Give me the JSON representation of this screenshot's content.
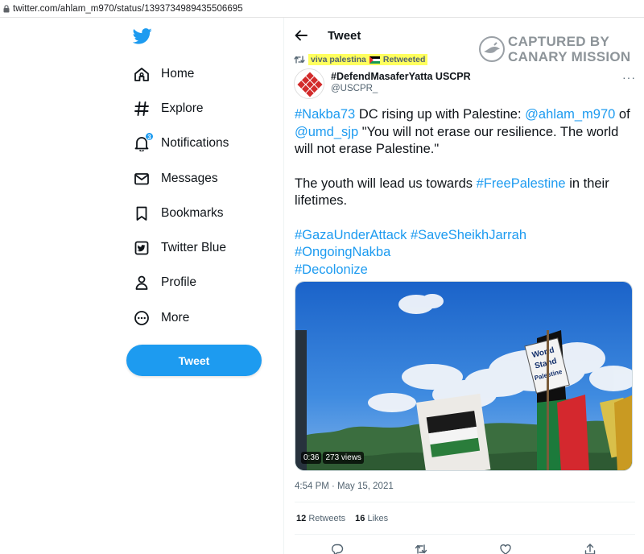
{
  "browser": {
    "url": "twitter.com/ahlam_m970/status/1393734989435506695"
  },
  "nav": {
    "items": [
      {
        "label": "Home",
        "icon": "home-icon"
      },
      {
        "label": "Explore",
        "icon": "hashtag-icon"
      },
      {
        "label": "Notifications",
        "icon": "bell-icon",
        "badge": "3"
      },
      {
        "label": "Messages",
        "icon": "envelope-icon"
      },
      {
        "label": "Bookmarks",
        "icon": "bookmark-icon"
      },
      {
        "label": "Twitter Blue",
        "icon": "twitter-blue-icon"
      },
      {
        "label": "Profile",
        "icon": "person-icon"
      },
      {
        "label": "More",
        "icon": "more-circle-icon"
      }
    ],
    "tweet_button": "Tweet"
  },
  "header": {
    "title": "Tweet"
  },
  "watermark": {
    "line1": "CAPTURED BY",
    "line2": "CANARY MISSION"
  },
  "retweet": {
    "name": "viva palestina",
    "suffix": "Retweeted"
  },
  "author": {
    "name": "#DefendMasaferYatta USCPR",
    "handle": "@USCPR_"
  },
  "tweet_text": {
    "p1": {
      "tag1": "#Nakba73",
      "t1": " DC rising up with Palestine: ",
      "mention1": "@ahlam_m970",
      "t2": " of ",
      "mention2": "@umd_sjp",
      "t3": " \"You will not erase our resilience. The world will not erase Palestine.\""
    },
    "p2": {
      "t1": "The youth will lead us towards ",
      "tag1": "#FreePalestine",
      "t2": " in their lifetimes."
    },
    "p3": {
      "tag1": "#GazaUnderAttack",
      "tag2": "#SaveSheikhJarrah",
      "tag3": "#OngoingNakba",
      "tag4": "#Decolonize"
    }
  },
  "media": {
    "duration": "0:36",
    "views": "273 views",
    "sign_text": [
      "World",
      "Stand",
      "Palestine"
    ]
  },
  "timestamp": "4:54 PM · May 15, 2021",
  "stats": {
    "retweets_count": "12",
    "retweets_label": "Retweets",
    "likes_count": "16",
    "likes_label": "Likes"
  },
  "colors": {
    "accent": "#1d9bf0",
    "highlight": "#ffff5e",
    "secondary_text": "#536471"
  }
}
